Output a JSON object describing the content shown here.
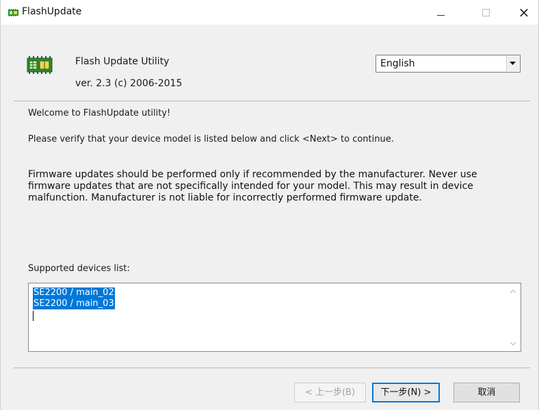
{
  "window": {
    "title": "FlashUpdate",
    "controls": {
      "minimize": "minimize",
      "maximize": "maximize",
      "close": "×"
    }
  },
  "header": {
    "product_name": "Flash Update Utility",
    "version": "ver. 2.3  (c) 2006-2015",
    "language": {
      "selected": "English"
    }
  },
  "body": {
    "welcome": "Welcome to FlashUpdate utility!",
    "verify": "Please verify that your device model is listed below and click <Next> to continue.",
    "warning": "Firmware updates should be performed only if recommended by the manufacturer. Never use firmware updates that are not specifically intended for your model. This may result in device malfunction. Manufacturer is not liable for incorrectly performed firmware update.",
    "supported_label": "Supported devices list:",
    "devices": [
      "SE2200 / main_02",
      "SE2200 / main_03"
    ]
  },
  "buttons": {
    "back": "< 上一步(B)",
    "next": "下一步(N) >",
    "cancel": "取消"
  },
  "colors": {
    "selection": "#0078d7",
    "window_bg": "#f0f0f0",
    "icon_green": "#2e8b2e"
  }
}
